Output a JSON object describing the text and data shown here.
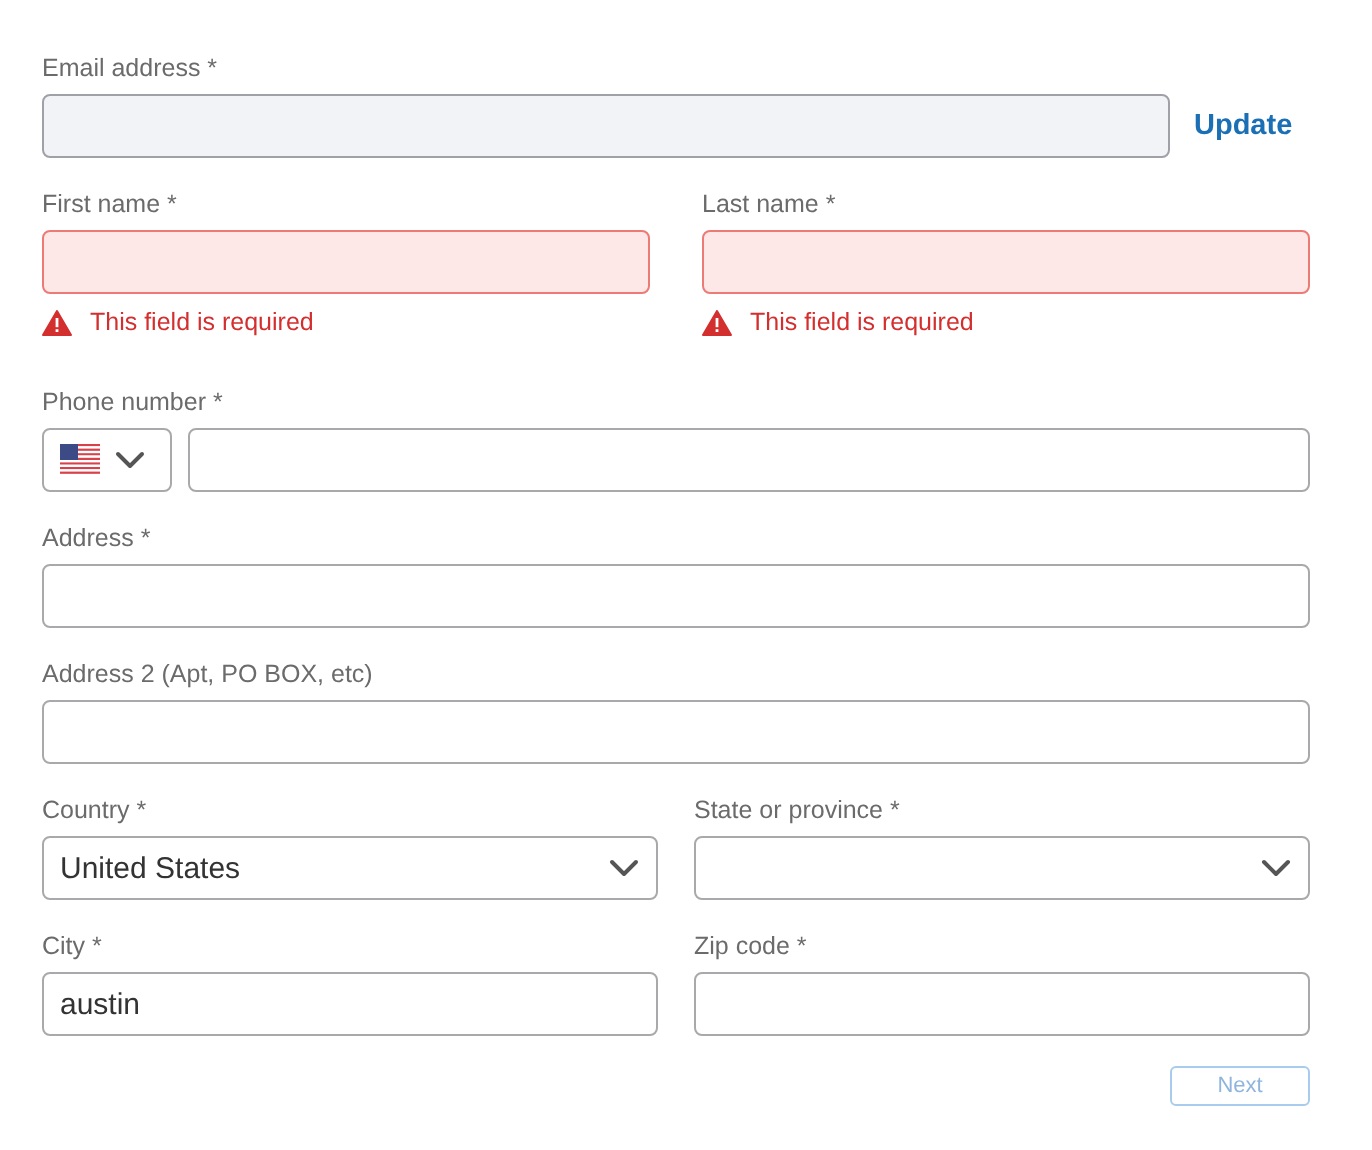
{
  "rows": [
    {
      "fields": [
        {
          "kind": "text",
          "label": "Email address *",
          "disabled": true
        }
      ],
      "action": {
        "label": "Update"
      }
    },
    {
      "fields": [
        {
          "kind": "text",
          "label": "First name *",
          "disabled": false,
          "error": "This field is required"
        },
        {
          "kind": "text",
          "label": "Last name *",
          "disabled": false,
          "error": "This field is required"
        }
      ]
    },
    {
      "fields": [
        {
          "kind": "phone",
          "label": "Phone number *",
          "disabled": false
        }
      ]
    },
    {
      "fields": [
        {
          "kind": "text",
          "label": "Address *",
          "disabled": false
        }
      ]
    },
    {
      "fields": [
        {
          "kind": "text",
          "label": "Address 2 (Apt, PO BOX, etc)",
          "disabled": false
        }
      ]
    },
    {
      "fields": [
        {
          "kind": "select",
          "label": "Country *",
          "disabled": false,
          "value": "United States"
        },
        {
          "kind": "select",
          "label": "State or province *",
          "disabled": false
        }
      ]
    },
    {
      "fields": [
        {
          "kind": "text",
          "label": "City *",
          "disabled": false,
          "value": "austin"
        },
        {
          "kind": "text",
          "label": "Zip code *",
          "disabled": false
        }
      ]
    }
  ],
  "next_button": {
    "label": "Next",
    "disabled": true
  }
}
